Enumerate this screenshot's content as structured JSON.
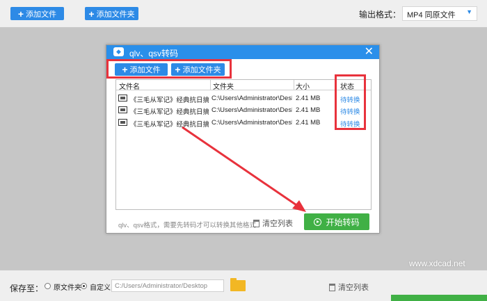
{
  "toolbar": {
    "add_file": "添加文件",
    "add_folder": "添加文件夹",
    "format_label": "输出格式：",
    "format_value": "MP4  同原文件"
  },
  "dialog": {
    "title": "qlv、qsv转码",
    "add_file": "添加文件",
    "add_folder": "添加文件夹",
    "columns": [
      "文件名",
      "文件夹",
      "大小",
      "状态"
    ],
    "rows": [
      {
        "name": "《三毛从军记》经典抗日搞笑剧",
        "folder": "C:\\Users\\Administrator\\Desktop",
        "size": "2.41 MB",
        "status": "待转换"
      },
      {
        "name": "《三毛从军记》经典抗日搞笑剧",
        "folder": "C:\\Users\\Administrator\\Desktop",
        "size": "2.41 MB",
        "status": "待转换"
      },
      {
        "name": "《三毛从军记》经典抗日搞笑剧",
        "folder": "C:\\Users\\Administrator\\Desktop",
        "size": "2.41 MB",
        "status": "待转换"
      }
    ],
    "note": "qlv、qsv格式，需要先转码才可以转换其他格式",
    "clear_list": "清空列表",
    "start": "开始转码"
  },
  "bottom": {
    "save_label": "保存至：",
    "option_original": "原文件夹",
    "option_custom": "自定义",
    "path": "C:/Users/Administrator/Desktop",
    "clear_list": "清空列表",
    "watermark": "www.xdcad.net"
  },
  "colors": {
    "accent_blue": "#2d8ae6",
    "start_green": "#40b045",
    "highlight_red": "#e8323c",
    "folder_yellow": "#f2b724"
  }
}
